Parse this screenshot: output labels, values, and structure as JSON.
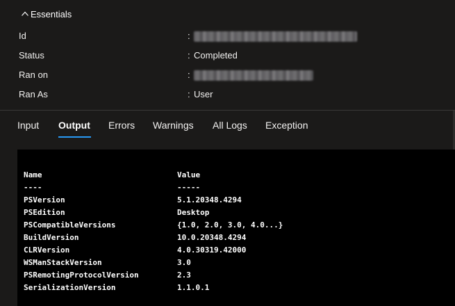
{
  "essentials": {
    "title": "Essentials",
    "separator": ":",
    "fields": [
      {
        "label": "Id",
        "value": ""
      },
      {
        "label": "Status",
        "value": "Completed"
      },
      {
        "label": "Ran on",
        "value": ""
      },
      {
        "label": "Ran As",
        "value": "User"
      }
    ]
  },
  "tabs": [
    {
      "label": "Input"
    },
    {
      "label": "Output"
    },
    {
      "label": "Errors"
    },
    {
      "label": "Warnings"
    },
    {
      "label": "All Logs"
    },
    {
      "label": "Exception"
    }
  ],
  "active_tab": "Output",
  "colors": {
    "background": "#1b1a19",
    "console_background": "#000000",
    "accent": "#2899f5"
  },
  "output": {
    "header": {
      "name": "Name",
      "value": "Value"
    },
    "underline": {
      "name": "----",
      "value": "-----"
    },
    "rows": [
      {
        "name": "PSVersion",
        "value": "5.1.20348.4294"
      },
      {
        "name": "PSEdition",
        "value": "Desktop"
      },
      {
        "name": "PSCompatibleVersions",
        "value": "{1.0, 2.0, 3.0, 4.0...}"
      },
      {
        "name": "BuildVersion",
        "value": "10.0.20348.4294"
      },
      {
        "name": "CLRVersion",
        "value": "4.0.30319.42000"
      },
      {
        "name": "WSManStackVersion",
        "value": "3.0"
      },
      {
        "name": "PSRemotingProtocolVersion",
        "value": "2.3"
      },
      {
        "name": "SerializationVersion",
        "value": "1.1.0.1"
      }
    ]
  }
}
